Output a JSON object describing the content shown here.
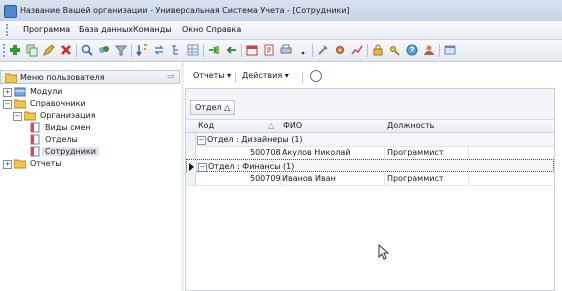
{
  "window": {
    "title": "Название Вашей организации - Универсальная Система Учета - [Сотрудники]"
  },
  "menu": {
    "items": [
      "Программа",
      "База данных",
      "Команды",
      "Окно",
      "Справка"
    ]
  },
  "toolbar": {
    "icons": [
      "add-icon",
      "copy-icon",
      "edit-icon",
      "delete-icon",
      "search-icon",
      "filter-icon",
      "funnel-icon",
      "sort-icon",
      "refresh-icon",
      "tree-icon",
      "grid-icon",
      "export-icon",
      "import-icon",
      "calendar-icon",
      "document-icon",
      "print-icon",
      "tools-icon",
      "settings-icon",
      "chart-icon",
      "lock-icon",
      "key-icon",
      "help-icon",
      "user-icon"
    ]
  },
  "sidebar": {
    "header_label": "Меню пользователя",
    "pin_glyph": "⫤",
    "tree": [
      {
        "label": "Модули",
        "level": 0,
        "expander": "+",
        "icon": "modules-icon"
      },
      {
        "label": "Справочники",
        "level": 0,
        "expander": "−",
        "icon": "folder-icon"
      },
      {
        "label": "Организация",
        "level": 1,
        "expander": "−",
        "icon": "folder-icon"
      },
      {
        "label": "Виды смен",
        "level": 2,
        "expander": "",
        "icon": "document-icon"
      },
      {
        "label": "Отделы",
        "level": 2,
        "expander": "",
        "icon": "document-icon"
      },
      {
        "label": "Сотрудники",
        "level": 2,
        "expander": "",
        "icon": "document-icon",
        "selected": true
      },
      {
        "label": "Отчеты",
        "level": 0,
        "expander": "+",
        "icon": "folder-icon"
      }
    ]
  },
  "panel_toolbar": {
    "reports_label": "Отчеты ▾",
    "actions_label": "Действия ▾"
  },
  "grid": {
    "group_chip": "Отдел △",
    "columns": {
      "code": "Код",
      "fio": "ФИО",
      "position": "Должность",
      "sort_marker": "△"
    },
    "groups": [
      {
        "label": "Отдел : Дизайнеры (1)",
        "rows": [
          {
            "code": "500708",
            "fio": "Акулов Николай",
            "position": "Программист"
          }
        ]
      },
      {
        "label": "Отдел : Финансы (1)",
        "current": true,
        "rows": [
          {
            "code": "500709",
            "fio": "Иванов Иван",
            "position": "Программист"
          }
        ]
      }
    ]
  },
  "colors": {
    "title_bar": "#c6d4e6",
    "selection": "#dfe4ea",
    "group_row": "#f4f6f9"
  }
}
